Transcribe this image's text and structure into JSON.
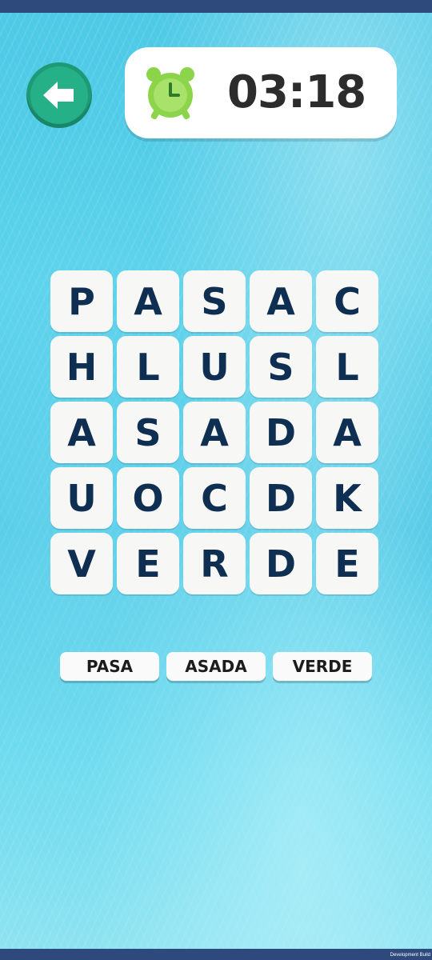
{
  "timer": {
    "value": "03:18"
  },
  "grid": {
    "rows": [
      [
        "P",
        "A",
        "S",
        "A",
        "C"
      ],
      [
        "H",
        "L",
        "U",
        "S",
        "L"
      ],
      [
        "A",
        "S",
        "A",
        "D",
        "A"
      ],
      [
        "U",
        "O",
        "C",
        "D",
        "K"
      ],
      [
        "V",
        "E",
        "R",
        "D",
        "E"
      ]
    ]
  },
  "words": [
    "PASA",
    "ASADA",
    "VERDE"
  ],
  "footer": {
    "build_label": "Development Build"
  },
  "colors": {
    "accent_green": "#25b088",
    "clock_green": "#8cd44a",
    "tile_text": "#0f2f52",
    "bar": "#2e4a7d"
  },
  "icons": {
    "back": "arrow-left-icon",
    "timer": "alarm-clock-icon"
  }
}
